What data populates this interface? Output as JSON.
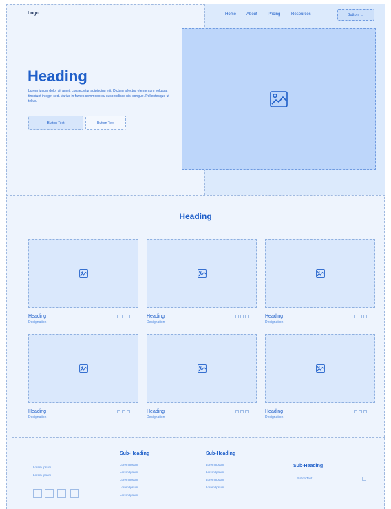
{
  "header": {
    "logo": "Logo",
    "nav": [
      "Home",
      "About",
      "Pricing",
      "Resources"
    ],
    "button_label": "Button",
    "button_arrow": "→"
  },
  "hero": {
    "title": "Heading",
    "paragraph": "Lorem ipsum dolor sit amet, consectetur adipiscing elit. Dictum a lectus elementum volutpat tincidunt in eget sed. Varius in fames commodo eu suspendisse nisi congue. Pellentesque ut tellus.",
    "primary_button": "Button Text",
    "secondary_button": "Button Text"
  },
  "team": {
    "heading": "Heading",
    "cards": [
      {
        "title": "Heading",
        "subtitle": "Designation"
      },
      {
        "title": "Heading",
        "subtitle": "Designation"
      },
      {
        "title": "Heading",
        "subtitle": "Designation"
      },
      {
        "title": "Heading",
        "subtitle": "Designation"
      },
      {
        "title": "Heading",
        "subtitle": "Designation"
      },
      {
        "title": "Heading",
        "subtitle": "Designation"
      }
    ]
  },
  "footer": {
    "left_text": [
      "Lorem Ipsum",
      "Lorem Ipsum"
    ],
    "col1": {
      "heading": "Sub-Heading",
      "items": [
        "Lorem Ipsum",
        "Lorem Ipsum",
        "Lorem Ipsum",
        "Lorem Ipsum",
        "Lorem Ipsum"
      ]
    },
    "col2": {
      "heading": "Sub-Heading",
      "items": [
        "Lorem Ipsum",
        "Lorem Ipsum",
        "Lorem Ipsum",
        "Lorem Ipsum"
      ]
    },
    "col3": {
      "heading": "Sub-Heading",
      "button_text": "Button Text"
    }
  },
  "colors": {
    "primary": "#1f5fc9",
    "page_bg": "#eef4fd",
    "hero_panel": "#dceafc",
    "image_placeholder": "#bdd6fa"
  }
}
